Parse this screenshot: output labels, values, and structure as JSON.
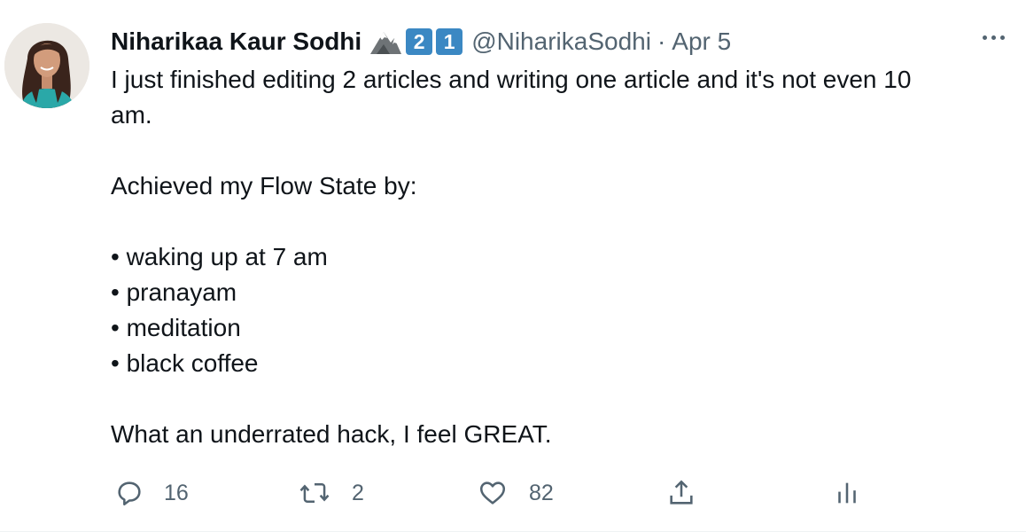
{
  "author": {
    "name": "Niharikaa Kaur Sodhi",
    "badges": [
      "mountain-icon",
      "keycap-2",
      "keycap-1"
    ],
    "keycap_digits": [
      "2",
      "1"
    ],
    "handle": "@NiharikaSodhi",
    "separator": "·",
    "date": "Apr 5"
  },
  "tweet": {
    "line1": "I just finished editing 2 articles and writing one article and it's not even 10",
    "line2": "am.",
    "line3": "Achieved my Flow State by:",
    "list": [
      "• waking up at 7 am",
      "• pranayam",
      "• meditation",
      "• black coffee"
    ],
    "closing": "What an underrated hack, I feel GREAT."
  },
  "actions": {
    "reply_count": "16",
    "retweet_count": "2",
    "like_count": "82"
  },
  "icons": {
    "reply": "reply-icon",
    "retweet": "retweet-icon",
    "like": "heart-icon",
    "share": "share-icon",
    "analytics": "analytics-icon",
    "more": "more-icon"
  },
  "colors": {
    "text": "#0f1419",
    "secondary": "#536471",
    "keycap": "#3b88c3"
  }
}
